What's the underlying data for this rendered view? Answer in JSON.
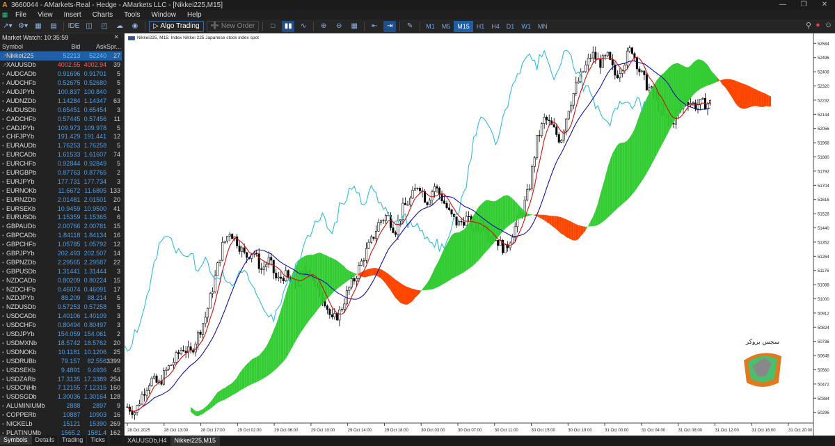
{
  "window": {
    "title": "3660044 - AMarkets-Real - Hedge - AMarkets LLC - [Nikkei225,M15]"
  },
  "menu": [
    "File",
    "View",
    "Insert",
    "Charts",
    "Tools",
    "Window",
    "Help"
  ],
  "toolbar": {
    "algo_label": "Algo Trading",
    "new_order_label": "New Order",
    "ide_label": "IDE",
    "timeframes": [
      "M1",
      "M5",
      "M15",
      "H1",
      "H4",
      "D1",
      "W1",
      "MN"
    ],
    "active_timeframe": "M15"
  },
  "market_watch": {
    "title": "Market Watch: 10:35:59",
    "headers": {
      "symbol": "Symbol",
      "bid": "Bid",
      "ask": "Ask",
      "spread": "Spr..."
    },
    "rows": [
      {
        "symbol": "Nikkei225",
        "bid": "52213",
        "ask": "52240",
        "spread": "27"
      },
      {
        "symbol": "XAUUSDb",
        "bid": "4002.55",
        "ask": "4002.94",
        "spread": "39"
      },
      {
        "symbol": "AUDCADb",
        "bid": "0.91696",
        "ask": "0.91701",
        "spread": "5"
      },
      {
        "symbol": "AUDCHFb",
        "bid": "0.52675",
        "ask": "0.52680",
        "spread": "5"
      },
      {
        "symbol": "AUDJPYb",
        "bid": "100.837",
        "ask": "100.840",
        "spread": "3"
      },
      {
        "symbol": "AUDNZDb",
        "bid": "1.14284",
        "ask": "1.14347",
        "spread": "63"
      },
      {
        "symbol": "AUDUSDb",
        "bid": "0.65451",
        "ask": "0.65454",
        "spread": "3"
      },
      {
        "symbol": "CADCHFb",
        "bid": "0.57445",
        "ask": "0.57456",
        "spread": "11"
      },
      {
        "symbol": "CADJPYb",
        "bid": "109.973",
        "ask": "109.978",
        "spread": "5"
      },
      {
        "symbol": "CHFJPYb",
        "bid": "191.429",
        "ask": "191.441",
        "spread": "12"
      },
      {
        "symbol": "EURAUDb",
        "bid": "1.76253",
        "ask": "1.76258",
        "spread": "5"
      },
      {
        "symbol": "EURCADb",
        "bid": "1.61533",
        "ask": "1.61607",
        "spread": "74"
      },
      {
        "symbol": "EURCHFb",
        "bid": "0.92844",
        "ask": "0.92849",
        "spread": "5"
      },
      {
        "symbol": "EURGBPb",
        "bid": "0.87763",
        "ask": "0.87765",
        "spread": "2"
      },
      {
        "symbol": "EURJPYb",
        "bid": "177.731",
        "ask": "177.734",
        "spread": "3"
      },
      {
        "symbol": "EURNOKb",
        "bid": "11.6672",
        "ask": "11.6805",
        "spread": "133"
      },
      {
        "symbol": "EURNZDb",
        "bid": "2.01481",
        "ask": "2.01501",
        "spread": "20"
      },
      {
        "symbol": "EURSEKb",
        "bid": "10.9459",
        "ask": "10.9500",
        "spread": "41"
      },
      {
        "symbol": "EURUSDb",
        "bid": "1.15359",
        "ask": "1.15365",
        "spread": "6"
      },
      {
        "symbol": "GBPAUDb",
        "bid": "2.00766",
        "ask": "2.00781",
        "spread": "15"
      },
      {
        "symbol": "GBPCADb",
        "bid": "1.84118",
        "ask": "1.84134",
        "spread": "16"
      },
      {
        "symbol": "GBPCHFb",
        "bid": "1.05785",
        "ask": "1.05792",
        "spread": "12"
      },
      {
        "symbol": "GBPJPYb",
        "bid": "202.493",
        "ask": "202.507",
        "spread": "14"
      },
      {
        "symbol": "GBPNZDb",
        "bid": "2.29565",
        "ask": "2.29587",
        "spread": "22"
      },
      {
        "symbol": "GBPUSDb",
        "bid": "1.31441",
        "ask": "1.31444",
        "spread": "3"
      },
      {
        "symbol": "NZDCADb",
        "bid": "0.80209",
        "ask": "0.80224",
        "spread": "15"
      },
      {
        "symbol": "NZDCHFb",
        "bid": "0.46074",
        "ask": "0.46091",
        "spread": "17"
      },
      {
        "symbol": "NZDJPYb",
        "bid": "88.209",
        "ask": "88.214",
        "spread": "5"
      },
      {
        "symbol": "NZDUSDb",
        "bid": "0.57253",
        "ask": "0.57258",
        "spread": "5"
      },
      {
        "symbol": "USDCADb",
        "bid": "1.40106",
        "ask": "1.40109",
        "spread": "3"
      },
      {
        "symbol": "USDCHFb",
        "bid": "0.80494",
        "ask": "0.80497",
        "spread": "3"
      },
      {
        "symbol": "USDJPYb",
        "bid": "154.059",
        "ask": "154.061",
        "spread": "2"
      },
      {
        "symbol": "USDMXNb",
        "bid": "18.5742",
        "ask": "18.5762",
        "spread": "20"
      },
      {
        "symbol": "USDNOKb",
        "bid": "10.1181",
        "ask": "10.1206",
        "spread": "25"
      },
      {
        "symbol": "USDRUBb",
        "bid": "79.157",
        "ask": "82.556",
        "spread": "3399"
      },
      {
        "symbol": "USDSEKb",
        "bid": "9.4891",
        "ask": "9.4936",
        "spread": "45"
      },
      {
        "symbol": "USDZARb",
        "bid": "17.3135",
        "ask": "17.3389",
        "spread": "254"
      },
      {
        "symbol": "USDCNHb",
        "bid": "7.12155",
        "ask": "7.12315",
        "spread": "160"
      },
      {
        "symbol": "USDSGDb",
        "bid": "1.30036",
        "ask": "1.30164",
        "spread": "128"
      },
      {
        "symbol": "ALUMINIUMb",
        "bid": "2888",
        "ask": "2897",
        "spread": "9"
      },
      {
        "symbol": "COPPERb",
        "bid": "10887",
        "ask": "10903",
        "spread": "16"
      },
      {
        "symbol": "NICKELb",
        "bid": "15121",
        "ask": "15390",
        "spread": "269"
      },
      {
        "symbol": "PLATINUMb",
        "bid": "1565.2",
        "ask": "1581.4",
        "spread": "162"
      }
    ],
    "tabs": [
      "Symbols",
      "Details",
      "Trading",
      "Ticks"
    ]
  },
  "chart": {
    "header": "Nikkei225, M15:  Index Nikkei 225 Japanese stock index spot",
    "tabs": [
      "XAUUSDb,H4",
      "Nikkei225,M15"
    ],
    "watermark_text": "سچس بروکر"
  },
  "chart_data": {
    "type": "candlestick",
    "y_ticks": [
      "52584",
      "52496",
      "52408",
      "52320",
      "52232",
      "52144",
      "52056",
      "51968",
      "51880",
      "51792",
      "51704",
      "51616",
      "51528",
      "51440",
      "51352",
      "51264",
      "51176",
      "51088",
      "51000",
      "50912",
      "50824",
      "50736",
      "50648",
      "50560",
      "50472",
      "50384",
      "50296"
    ],
    "x_ticks": [
      "28 Oct 2025",
      "28 Oct 13:00",
      "28 Oct 17:00",
      "29 Oct 02:00",
      "29 Oct 06:00",
      "29 Oct 10:00",
      "29 Oct 14:00",
      "29 Oct 18:00",
      "30 Oct 03:00",
      "30 Oct 07:00",
      "30 Oct 11:00",
      "30 Oct 15:00",
      "30 Oct 19:00",
      "31 Oct 00:00",
      "31 Oct 04:00",
      "31 Oct 08:00",
      "31 Oct 12:00",
      "31 Oct 16:00",
      "31 Oct 20:00"
    ],
    "ylim": [
      50230,
      52620
    ],
    "close_path": [
      50330,
      50300,
      50420,
      50500,
      50470,
      50560,
      50620,
      50700,
      50660,
      50780,
      50900,
      51100,
      51320,
      51420,
      51350,
      51260,
      51300,
      51180,
      51240,
      51110,
      51150,
      51080,
      51120,
      51200,
      51060,
      51000,
      50860,
      50920,
      51050,
      51140,
      51260,
      51360,
      51480,
      51520,
      51420,
      51560,
      51620,
      51720,
      51600,
      51700,
      51620,
      51520,
      51460,
      51500,
      51440,
      51480,
      51400,
      51360,
      51300,
      51420,
      51520,
      51680,
      51980,
      52120,
      52060,
      51980,
      52180,
      52320,
      52420,
      52520,
      52460,
      52500,
      52380,
      52460,
      52560,
      52420,
      52320,
      52260,
      52140,
      52080,
      52160,
      52240,
      52200,
      52210,
      52213
    ],
    "ichimoku_cloud_green": "upper span above lower span",
    "ichimoku_cloud_red": "lower span above upper span",
    "colors": {
      "bull_cloud": "#33cc33",
      "bear_cloud": "#ff4500",
      "tenkan": "#d01010",
      "kijun": "#1010b0",
      "chikou": "#33bbdd",
      "candles": "#000000"
    }
  }
}
